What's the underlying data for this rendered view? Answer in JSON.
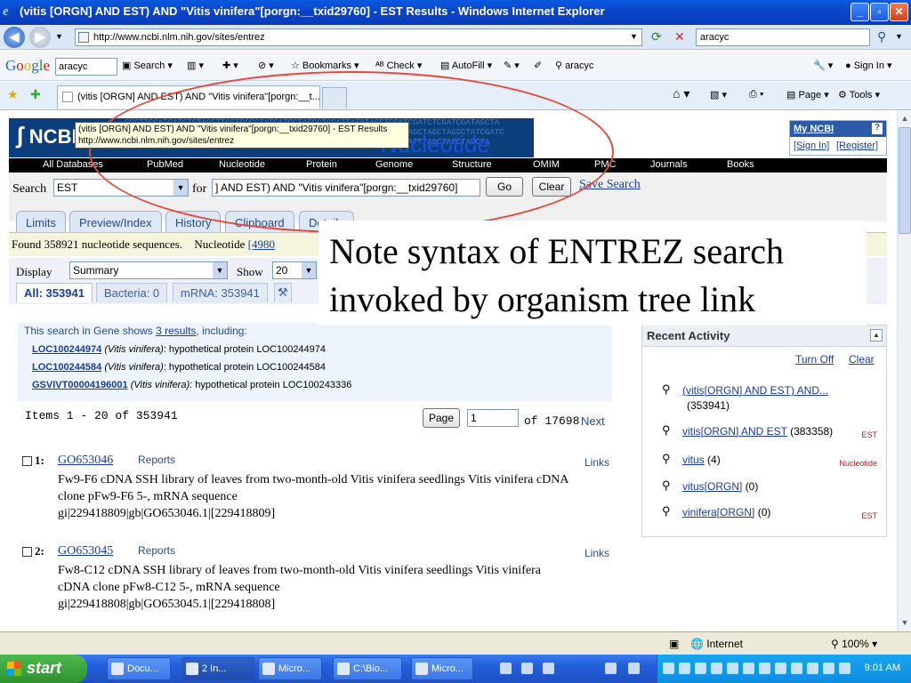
{
  "window": {
    "title": "(vitis [ORGN] AND EST) AND \"Vitis vinifera\"[porgn:__txid29760] - EST Results - Windows Internet Explorer"
  },
  "addressbar": {
    "url": "http://www.ncbi.nlm.nih.gov/sites/entrez",
    "search_value": "aracyc"
  },
  "google_toolbar": {
    "logo": "Google",
    "query": "aracyc",
    "search_label": "Search",
    "bookmarks_label": "Bookmarks",
    "check_label": "Check",
    "autofill_label": "AutoFill",
    "highlight_term": "aracyc",
    "signin_label": "Sign In"
  },
  "tabbar": {
    "tab_title": "(vitis [ORGN] AND EST) AND \"Vitis vinifera\"[porgn:__t...",
    "page_label": "Page",
    "tools_label": "Tools"
  },
  "ncbi": {
    "logo": "NCBI",
    "db_name": "Nucleotide",
    "dna_line1": "CCCTTCCATGATCTGTACCTTCCTCCGCTATCATGCTATGCTGCATTATATAGCTCGATCGATCTCGATCGATAGCTA",
    "dna_line2": "GCTTAGCTAGCTAGCATCGATCGATCGATCGAGCTATCGCGCATAGCATGCATCGATCTAGCTAGCTAGGCTATCGATC",
    "dna_line3": "CACAGACTAGCATCGACGATCAGCTAGCAGCAGCTTACTAACCAATTGCGGCTAGCCGAATTTAGCTAGCTAGCTA",
    "nav": [
      "All Databases",
      "PubMed",
      "Nucleotide",
      "Protein",
      "Genome",
      "Structure",
      "OMIM",
      "PMC",
      "Journals",
      "Books"
    ],
    "myncbi_title": "My NCBI",
    "myncbi_help": "?",
    "signin": "[Sign In]",
    "register": "[Register]"
  },
  "search_form": {
    "search_label": "Search",
    "db_value": "EST",
    "for_label": "for",
    "query": "] AND EST) AND \"Vitis vinifera\"[porgn:__txid29760]",
    "go_label": "Go",
    "clear_label": "Clear",
    "save_search": "Save Search"
  },
  "tooltip": {
    "line1": "(vitis [ORGN] AND EST) AND \"Vitis vinifera\"[porgn:__txid29760] - EST Results",
    "line2": "http://www.ncbi.nlm.nih.gov/sites/entrez"
  },
  "tabs": [
    "Limits",
    "Preview/Index",
    "History",
    "Clipboard",
    "Details"
  ],
  "found": {
    "text": "Found 358921 nucleotide sequences.",
    "db_label": "Nucleotide",
    "link_fragment": "[4980"
  },
  "display": {
    "label": "Display",
    "value": "Summary",
    "show_label": "Show",
    "show_value": "20"
  },
  "filters": [
    "All: 353941",
    "Bacteria: 0",
    "mRNA: 353941"
  ],
  "gene_box": {
    "intro_prefix": "This search in Gene shows",
    "intro_link": "3 results",
    "intro_suffix": ", including:",
    "rows": [
      {
        "id": "LOC100244974",
        "org": "(Vitis vinifera)",
        "desc": ": hypothetical protein LOC100244974"
      },
      {
        "id": "LOC100244584",
        "org": "(Vitis vinifera)",
        "desc": ": hypothetical protein LOC100244584"
      },
      {
        "id": "GSVIVT00004196001",
        "org": "(Vitis vinifera)",
        "desc": ": hypothetical protein LOC100243336"
      }
    ]
  },
  "pager": {
    "items_text": "Items 1 - 20 of 353941",
    "page_label": "Page",
    "page_value": "1",
    "of_text": "of 17698",
    "next_label": "Next"
  },
  "results": [
    {
      "num": "1:",
      "acc": "GO653046",
      "reports": "Reports",
      "links": "Links",
      "line1": "Fw9-F6 cDNA SSH library of leaves from two-month-old Vitis vinifera seedlings Vitis vinifera cDNA",
      "line2": "clone pFw9-F6 5-, mRNA sequence",
      "line3": "gi|229418809|gb|GO653046.1|[229418809]"
    },
    {
      "num": "2:",
      "acc": "GO653045",
      "reports": "Reports",
      "links": "Links",
      "line1": "Fw8-C12 cDNA SSH library of leaves from two-month-old Vitis vinifera seedlings Vitis vinifera",
      "line2": "cDNA clone pFw8-C12 5-, mRNA sequence",
      "line3": "gi|229418808|gb|GO653045.1|[229418808]"
    }
  ],
  "recent": {
    "title": "Recent Activity",
    "turn_off": "Turn Off",
    "clear": "Clear",
    "items": [
      {
        "q": "(vitis[ORGN] AND EST) AND...",
        "count": "(353941)",
        "tag": ""
      },
      {
        "q": "vitis[ORGN] AND EST",
        "count": "(383358)",
        "tag": "EST"
      },
      {
        "q": "vitus",
        "count": "(4)",
        "tag": "Nucleotide"
      },
      {
        "q": "vitus[ORGN]",
        "count": "(0)",
        "tag": ""
      },
      {
        "q": "vinifera[ORGN]",
        "count": "(0)",
        "tag": "EST"
      }
    ]
  },
  "annotation": {
    "text": "Note syntax of ENTREZ search invoked by organism tree link"
  },
  "statusbar": {
    "zone": "Internet",
    "zoom": "100%"
  },
  "taskbar": {
    "start": "start",
    "tasks": [
      "Docu...",
      "2 In...",
      "Micro...",
      "C:\\Bio...",
      "Micro..."
    ],
    "clock": "9:01 AM"
  }
}
